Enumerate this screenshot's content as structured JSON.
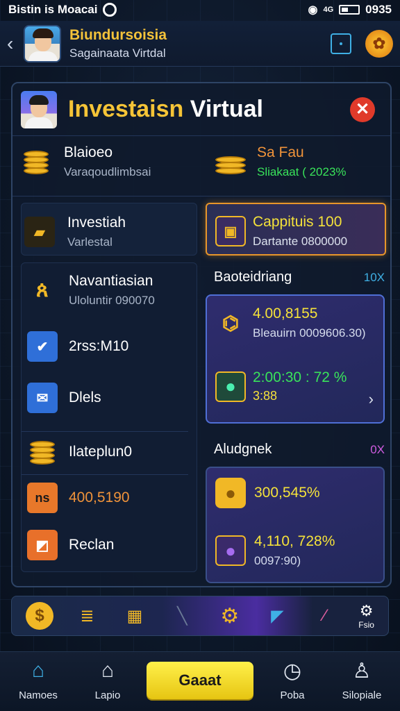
{
  "status": {
    "left_text": "Bistin is Moacai",
    "right_text": "0935",
    "network": "4G"
  },
  "header": {
    "title": "Biundursoisia",
    "subtitle": "Sagainaata Virtdal"
  },
  "panel": {
    "title_gold": "Investaisn",
    "title_white": "Virtual",
    "balance": {
      "label": "Blaioeo",
      "sub": "Varaqoudlimbsai"
    },
    "fav": {
      "label": "Sa Fau",
      "sub": "Sliakaat ( 2023%"
    },
    "invest": {
      "label": "Investiah",
      "sub": "Varlestal"
    },
    "capital": {
      "label": "Cappituis 100",
      "sub": "Dartante 0800000"
    },
    "menu": [
      {
        "label": "Navantiasian",
        "sub": "Uloluntir 090070"
      },
      {
        "label": "2rss:M10",
        "sub": ""
      },
      {
        "label": "Dlels",
        "sub": ""
      },
      {
        "label": "Ilateplun0",
        "sub": ""
      },
      {
        "label": "400,5190",
        "sub": ""
      },
      {
        "label": "Reclan",
        "sub": ""
      }
    ],
    "section1": {
      "title": "Baoteidriang",
      "badge": "10X",
      "value1": "4.00,8155",
      "desc1": "Bleauirn 0009606.30)",
      "value2": "2:00:30 : 72 %",
      "value3": "3:88"
    },
    "section2": {
      "title": "Aludgnek",
      "badge": "0X",
      "value1": "300,545%",
      "value2": "4,110, 728%",
      "desc2": "0097:90)"
    }
  },
  "strip": {
    "gear_label": "Fsio"
  },
  "nav": {
    "items": [
      {
        "label": "Namoes",
        "icon": "home-icon"
      },
      {
        "label": "Lapio",
        "icon": "house-icon"
      },
      {
        "label": "Poba",
        "icon": "clock-icon"
      },
      {
        "label": "Silopiale",
        "icon": "user-icon"
      }
    ],
    "main_button": "Gaaat"
  },
  "colors": {
    "gold": "#f5c437",
    "accent_blue": "#3fb0e5",
    "close_red": "#e03a2a",
    "green": "#39e35a",
    "nav_yellow": "#f2dc25"
  }
}
